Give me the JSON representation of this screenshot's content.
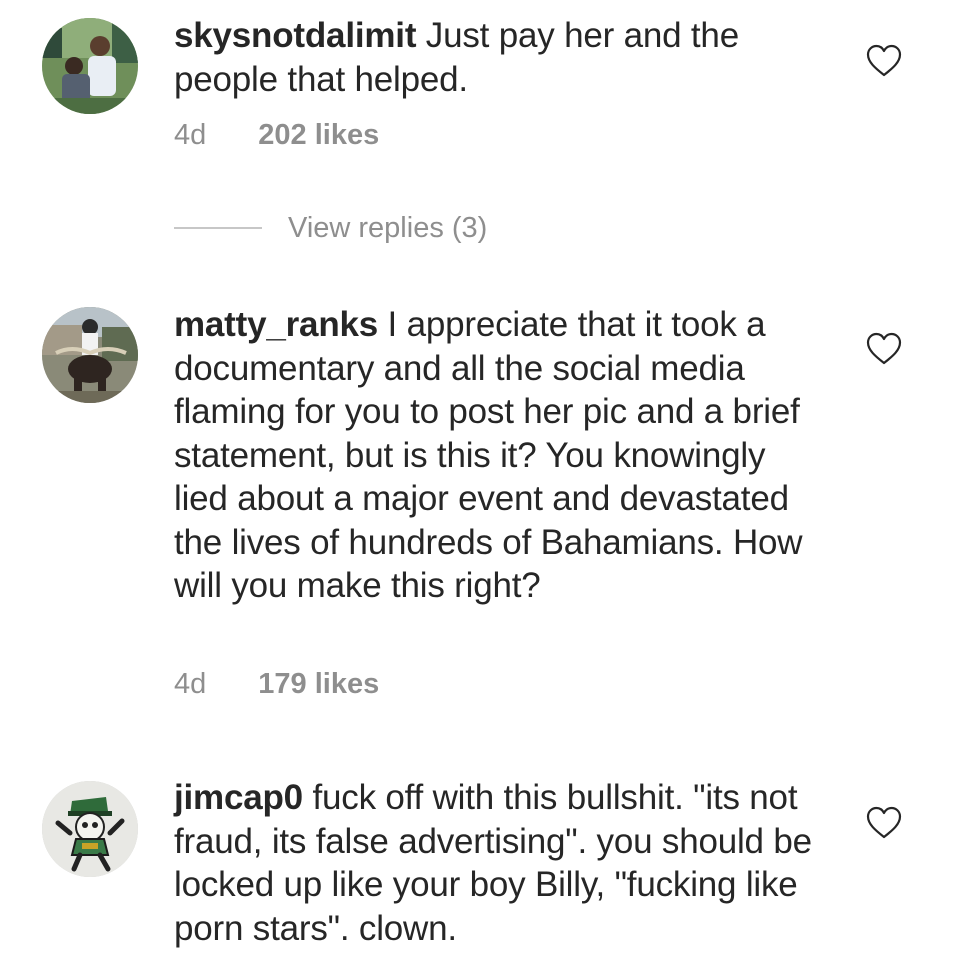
{
  "comments": [
    {
      "username": "skysnotdalimit",
      "text": " Just pay her and the people that helped.",
      "time": "4d",
      "likes": "202 likes",
      "avatar": "couple-photo-avatar",
      "view_replies": "View replies (3)"
    },
    {
      "username": "matty_ranks",
      "text": " I appreciate that it took a documentary and all the social media flaming for you to post her pic and a brief statement, but is this it? You knowingly lied about a major event and devastated the lives of hundreds of Bahamians. How will you make this right?",
      "time": "4d",
      "likes": "179 likes",
      "avatar": "bull-rider-avatar"
    },
    {
      "username": "jimcap0",
      "text": " fuck off with this bullshit. \"its not fraud, its false advertising\". you should be locked up like your boy Billy, \"fucking like porn stars\". clown.",
      "avatar": "leprechaun-skull-avatar"
    }
  ],
  "icons": {
    "like": "heart-outline-icon"
  },
  "colors": {
    "text": "#262626",
    "secondary": "#8e8e8e",
    "divider": "#c7c7c7",
    "background": "#ffffff"
  }
}
